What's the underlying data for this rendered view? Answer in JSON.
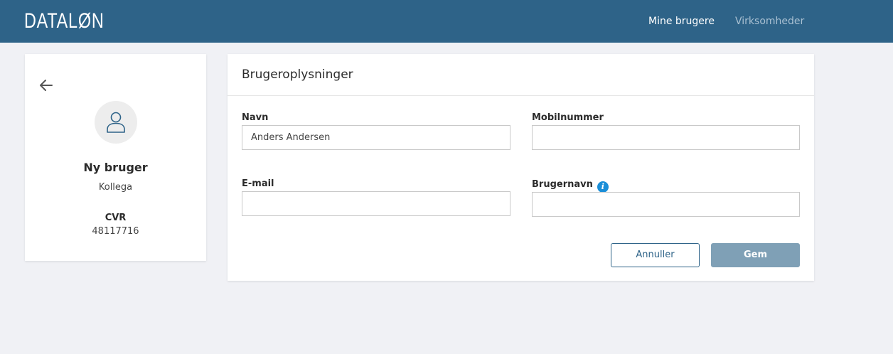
{
  "header": {
    "logo": "DATALØN",
    "nav": [
      {
        "label": "Mine brugere",
        "active": true
      },
      {
        "label": "Virksomheder",
        "active": false
      }
    ]
  },
  "profile": {
    "back_icon": "arrow-left-icon",
    "avatar_icon": "user-icon",
    "name": "Ny bruger",
    "role": "Kollega",
    "cvr_label": "CVR",
    "cvr_value": "48117716"
  },
  "form": {
    "title": "Brugeroplysninger",
    "fields": {
      "name": {
        "label": "Navn",
        "value": "Anders Andersen"
      },
      "mobile": {
        "label": "Mobilnummer",
        "value": ""
      },
      "email": {
        "label": "E-mail",
        "value": ""
      },
      "username": {
        "label": "Brugernavn",
        "value": "",
        "info_icon": "info-icon",
        "info_glyph": "i"
      }
    },
    "buttons": {
      "cancel": "Annuller",
      "save": "Gem"
    }
  },
  "colors": {
    "header_bg": "#2e6388",
    "page_bg": "#f0f1f5",
    "save_button": "#7fa0b6",
    "info_accent": "#1a8ed8"
  }
}
